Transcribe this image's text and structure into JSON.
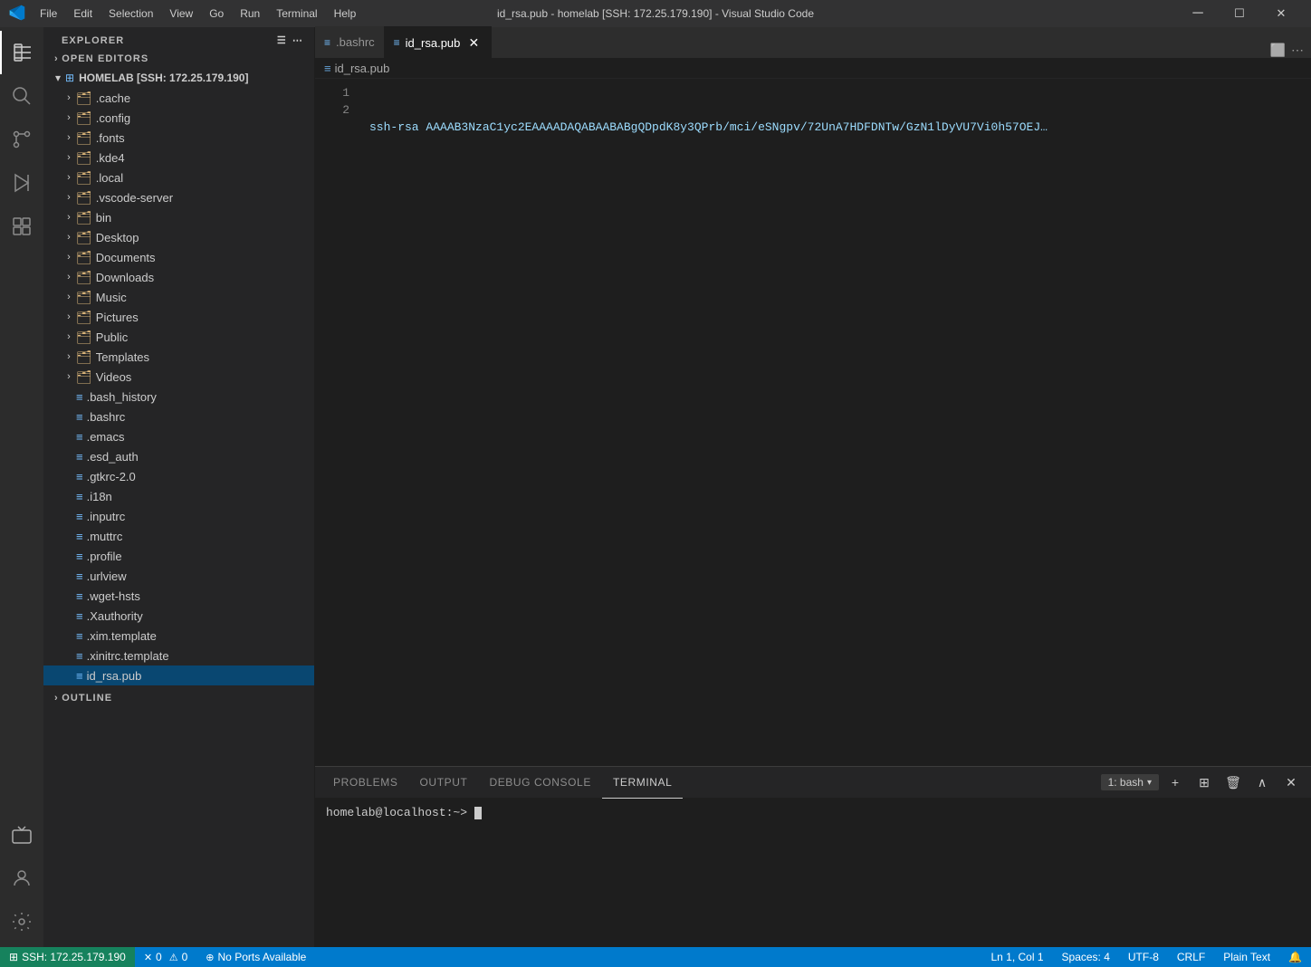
{
  "titlebar": {
    "title": "id_rsa.pub - homelab [SSH: 172.25.179.190] - Visual Studio Code",
    "menu": [
      "File",
      "Edit",
      "Selection",
      "View",
      "Go",
      "Run",
      "Terminal",
      "Help"
    ],
    "controls": [
      "─",
      "☐",
      "✕"
    ]
  },
  "activity_bar": {
    "icons": [
      {
        "name": "explorer-icon",
        "symbol": "⎘",
        "active": true
      },
      {
        "name": "search-icon",
        "symbol": "🔍",
        "active": false
      },
      {
        "name": "source-control-icon",
        "symbol": "⎇",
        "active": false
      },
      {
        "name": "run-debug-icon",
        "symbol": "▶",
        "active": false
      },
      {
        "name": "extensions-icon",
        "symbol": "⊞",
        "active": false
      }
    ],
    "bottom_icons": [
      {
        "name": "remote-icon",
        "symbol": "⊞"
      },
      {
        "name": "account-icon",
        "symbol": "👤"
      },
      {
        "name": "settings-icon",
        "symbol": "⚙"
      }
    ]
  },
  "sidebar": {
    "header": "EXPLORER",
    "open_editors_label": "OPEN EDITORS",
    "open_editors_collapsed": true,
    "root_label": "HOMELAB [SSH: 172.25.179.190]",
    "folders": [
      {
        "name": ".cache",
        "indent": 1,
        "type": "folder",
        "expanded": false
      },
      {
        "name": ".config",
        "indent": 1,
        "type": "folder",
        "expanded": false
      },
      {
        "name": ".fonts",
        "indent": 1,
        "type": "folder",
        "expanded": false
      },
      {
        "name": ".kde4",
        "indent": 1,
        "type": "folder",
        "expanded": false
      },
      {
        "name": ".local",
        "indent": 1,
        "type": "folder",
        "expanded": false
      },
      {
        "name": ".vscode-server",
        "indent": 1,
        "type": "folder",
        "expanded": false
      },
      {
        "name": "bin",
        "indent": 1,
        "type": "folder",
        "expanded": false
      },
      {
        "name": "Desktop",
        "indent": 1,
        "type": "folder",
        "expanded": false
      },
      {
        "name": "Documents",
        "indent": 1,
        "type": "folder",
        "expanded": false
      },
      {
        "name": "Downloads",
        "indent": 1,
        "type": "folder",
        "expanded": false
      },
      {
        "name": "Music",
        "indent": 1,
        "type": "folder",
        "expanded": false
      },
      {
        "name": "Pictures",
        "indent": 1,
        "type": "folder",
        "expanded": false
      },
      {
        "name": "Public",
        "indent": 1,
        "type": "folder",
        "expanded": false
      },
      {
        "name": "Templates",
        "indent": 1,
        "type": "folder",
        "expanded": false
      },
      {
        "name": "Videos",
        "indent": 1,
        "type": "folder",
        "expanded": false
      },
      {
        "name": ".bash_history",
        "indent": 1,
        "type": "file"
      },
      {
        "name": ".bashrc",
        "indent": 1,
        "type": "file"
      },
      {
        "name": ".emacs",
        "indent": 1,
        "type": "file"
      },
      {
        "name": ".esd_auth",
        "indent": 1,
        "type": "file"
      },
      {
        "name": ".gtkrc-2.0",
        "indent": 1,
        "type": "file"
      },
      {
        "name": ".i18n",
        "indent": 1,
        "type": "file"
      },
      {
        "name": ".inputrc",
        "indent": 1,
        "type": "file"
      },
      {
        "name": ".muttrc",
        "indent": 1,
        "type": "file"
      },
      {
        "name": ".profile",
        "indent": 1,
        "type": "file"
      },
      {
        "name": ".urlview",
        "indent": 1,
        "type": "file"
      },
      {
        "name": ".wget-hsts",
        "indent": 1,
        "type": "file"
      },
      {
        "name": ".Xauthority",
        "indent": 1,
        "type": "file"
      },
      {
        "name": ".xim.template",
        "indent": 1,
        "type": "file"
      },
      {
        "name": ".xinitrc.template",
        "indent": 1,
        "type": "file"
      },
      {
        "name": "id_rsa.pub",
        "indent": 1,
        "type": "file",
        "selected": true
      }
    ]
  },
  "tabs": [
    {
      "name": ".bashrc",
      "active": false,
      "icon": "≡"
    },
    {
      "name": "id_rsa.pub",
      "active": true,
      "icon": "≡"
    }
  ],
  "breadcrumb": "id_rsa.pub",
  "editor": {
    "lines": [
      {
        "num": 1,
        "content": "ssh-rsa AAAAB3NzaC1yc2EAAAADAQABAABABgQDpdK8y3QPrb/mci/eSNgpv/72UnA7HDFDNTw/GzN1lDyVU7Vi0h57OEJ…"
      },
      {
        "num": 2,
        "content": ""
      }
    ]
  },
  "panel": {
    "tabs": [
      "PROBLEMS",
      "OUTPUT",
      "DEBUG CONSOLE",
      "TERMINAL"
    ],
    "active_tab": "TERMINAL",
    "terminal_selector": "1: bash",
    "terminal_prompt": "homelab@localhost:~> "
  },
  "status_bar": {
    "ssh_label": "SSH: 172.25.179.190",
    "errors": "0",
    "warnings": "0",
    "no_ports": "No Ports Available",
    "line_col": "Ln 1, Col 1",
    "spaces": "Spaces: 4",
    "encoding": "UTF-8",
    "line_ending": "CRLF",
    "language": "Plain Text"
  }
}
